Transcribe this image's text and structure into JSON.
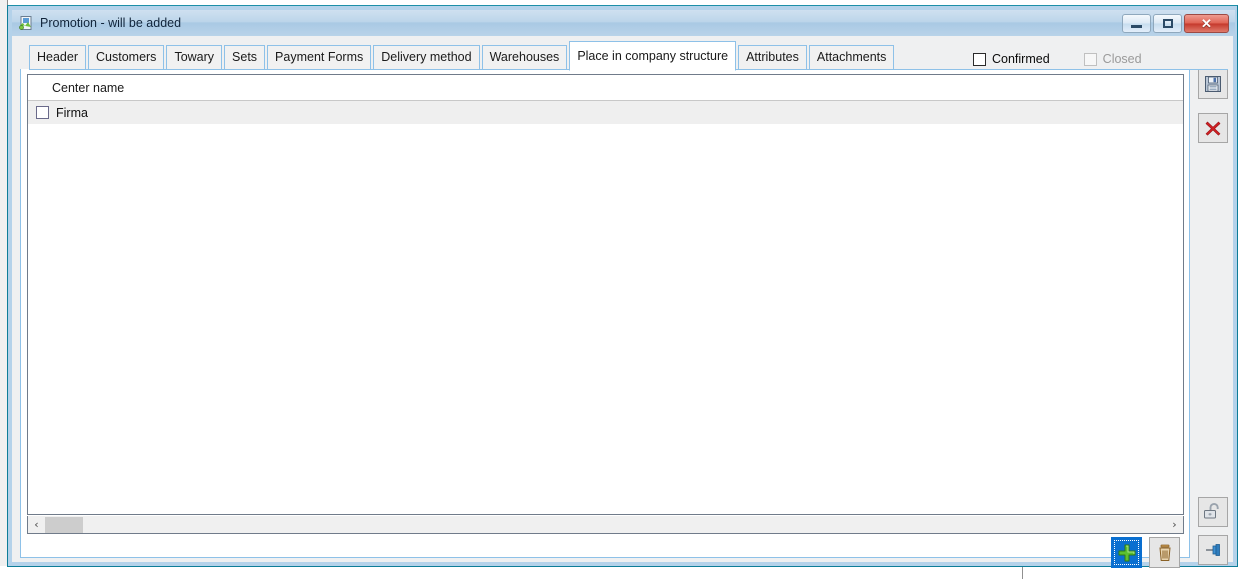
{
  "window": {
    "title": "Promotion - will be added",
    "app_icon": "promotion-app-icon",
    "controls": {
      "minimize": "minimize-button",
      "maximize": "maximize-button",
      "close": "close-button",
      "close_glyph": "✕"
    }
  },
  "tabs": [
    {
      "label": "Header",
      "active": false
    },
    {
      "label": "Customers",
      "active": false
    },
    {
      "label": "Towary",
      "active": false
    },
    {
      "label": "Sets",
      "active": false
    },
    {
      "label": "Payment Forms",
      "active": false
    },
    {
      "label": "Delivery method",
      "active": false
    },
    {
      "label": "Warehouses",
      "active": false
    },
    {
      "label": "Place in company structure",
      "active": true
    },
    {
      "label": "Attributes",
      "active": false
    },
    {
      "label": "Attachments",
      "active": false
    }
  ],
  "flags": [
    {
      "label": "Confirmed",
      "checked": false,
      "disabled": false
    },
    {
      "label": "Closed",
      "checked": false,
      "disabled": true
    }
  ],
  "grid": {
    "columns": [
      "Center name"
    ],
    "rows": [
      {
        "checked": false,
        "name": "Firma"
      }
    ]
  },
  "scrollbar": {
    "left_arrow": "‹",
    "right_arrow": "›"
  },
  "panel_actions": [
    {
      "name": "add-button",
      "icon": "green-plus-icon",
      "focused": true
    },
    {
      "name": "delete-button",
      "icon": "trash-can-icon",
      "focused": false
    }
  ],
  "side_toolbar": [
    {
      "name": "save-button",
      "icon": "floppy-disk-icon"
    },
    {
      "name": "cancel-button",
      "icon": "red-x-icon"
    },
    {
      "name": "unlock-button",
      "icon": "open-padlock-icon"
    },
    {
      "name": "pin-button",
      "icon": "pin-icon"
    }
  ],
  "colors": {
    "titlebar_top": "#cfe0f0",
    "titlebar_bottom": "#b9d3e9",
    "window_border": "#0d7d98",
    "tab_border": "#8ec1e8",
    "row_background": "#efefef",
    "accent_focus": "#0a6fd0",
    "plus_green": "#56b837",
    "close_red": "#c5392c"
  }
}
